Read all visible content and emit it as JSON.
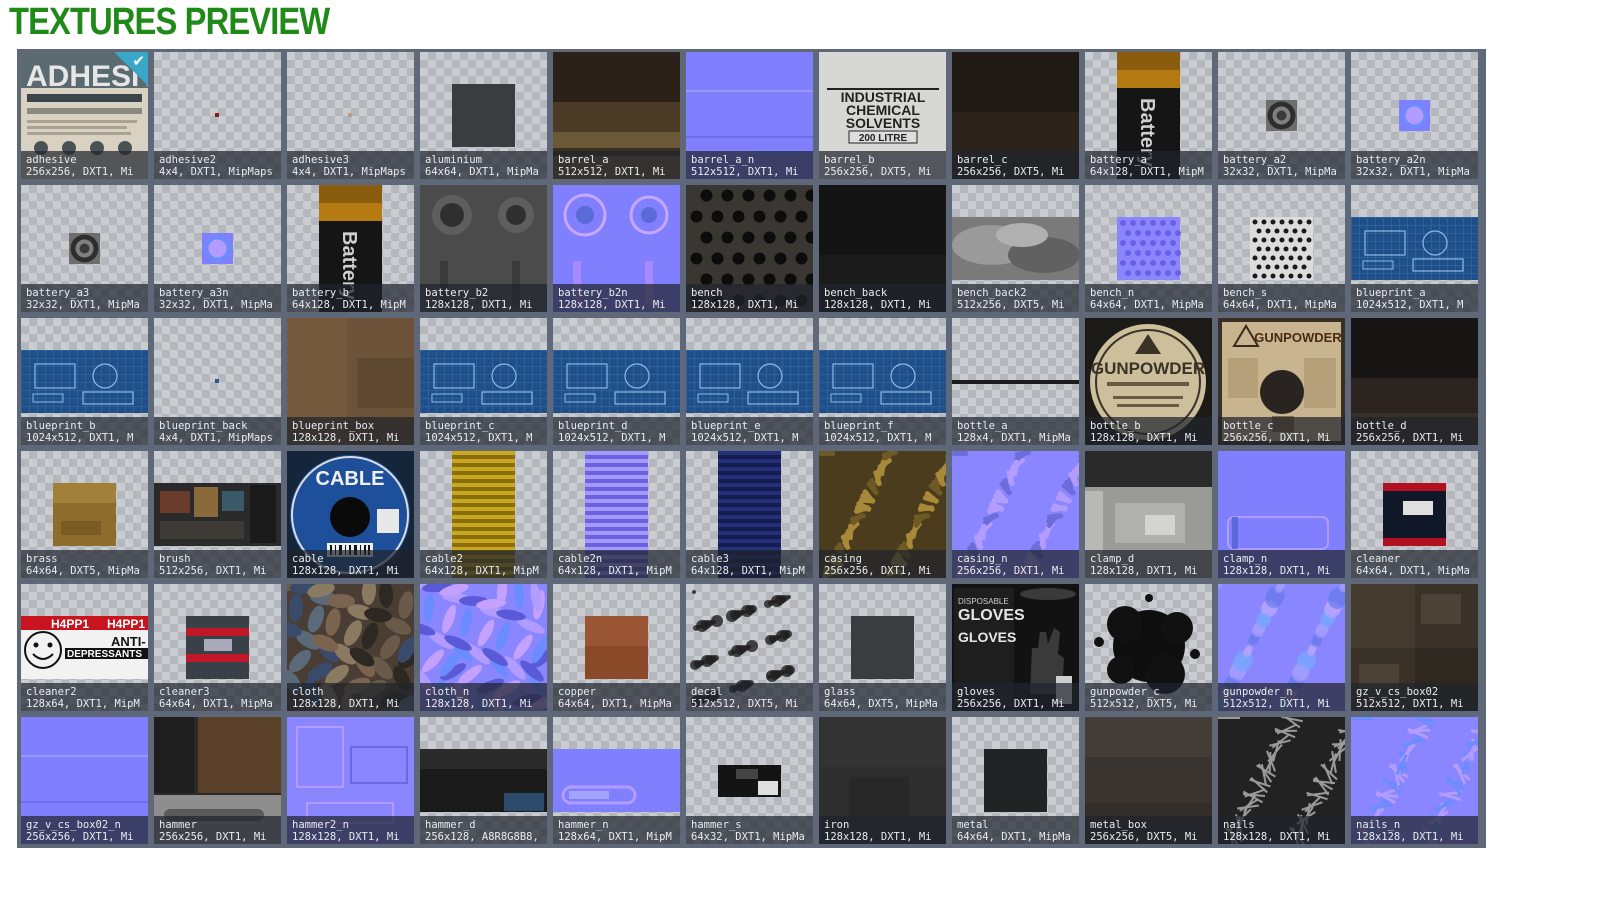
{
  "page": {
    "title": "TEXTURES PREVIEW"
  },
  "textures": [
    {
      "name": "adhesive",
      "info": "256x256, DXT1, Mi",
      "look": "adhesive",
      "selected": true
    },
    {
      "name": "adhesive2",
      "info": "4x4, DXT1, MipMaps",
      "look": "dot-red"
    },
    {
      "name": "adhesive3",
      "info": "4x4, DXT1, MipMaps",
      "look": "dot-tan"
    },
    {
      "name": "aluminium",
      "info": "64x64, DXT1, MipMa",
      "look": "square-dark"
    },
    {
      "name": "barrel_a",
      "info": "512x512, DXT1, Mi",
      "look": "barrel"
    },
    {
      "name": "barrel_a_n",
      "info": "512x512, DXT1, Mi",
      "look": "normal"
    },
    {
      "name": "barrel_b",
      "info": "256x256, DXT5, Mi",
      "look": "chem-label",
      "label_lines": [
        "INDUSTRIAL",
        "CHEMICAL",
        "SOLVENTS",
        "200 LITRE"
      ]
    },
    {
      "name": "barrel_c",
      "info": "256x256, DXT5, Mi",
      "look": "dark-wood"
    },
    {
      "name": "battery_a",
      "info": "64x128, DXT1, MipM",
      "look": "battery-label",
      "label_text": "Battery"
    },
    {
      "name": "battery_a2",
      "info": "32x32, DXT1, MipMa",
      "look": "small-disc"
    },
    {
      "name": "battery_a2n",
      "info": "32x32, DXT1, MipMa",
      "look": "small-disc-n"
    },
    {
      "name": "battery_a3",
      "info": "32x32, DXT1, MipMa",
      "look": "small-disc"
    },
    {
      "name": "battery_a3n",
      "info": "32x32, DXT1, MipMa",
      "look": "small-disc-n"
    },
    {
      "name": "battery_b",
      "info": "64x128, DXT1, MipM",
      "look": "battery-label",
      "label_text": "Battery"
    },
    {
      "name": "battery_b2",
      "info": "128x128, DXT1, Mi",
      "look": "metal-knobs"
    },
    {
      "name": "battery_b2n",
      "info": "128x128, DXT1, Mi",
      "look": "normal-knobs"
    },
    {
      "name": "bench",
      "info": "128x128, DXT1, Mi",
      "look": "dots-dark"
    },
    {
      "name": "bench_back",
      "info": "128x128, DXT1, Mi",
      "look": "black"
    },
    {
      "name": "bench_back2",
      "info": "512x256, DXT5, Mi",
      "look": "cloud"
    },
    {
      "name": "bench_n",
      "info": "64x64, DXT1, MipMa",
      "look": "normal-square"
    },
    {
      "name": "bench_s",
      "info": "64x64, DXT1, MipMa",
      "look": "dots-light"
    },
    {
      "name": "blueprint_a",
      "info": "1024x512, DXT1, M",
      "look": "blueprint"
    },
    {
      "name": "blueprint_b",
      "info": "1024x512, DXT1, M",
      "look": "blueprint"
    },
    {
      "name": "blueprint_back",
      "info": "4x4, DXT1, MipMaps",
      "look": "dot-blue"
    },
    {
      "name": "blueprint_box",
      "info": "128x128, DXT1, Mi",
      "look": "cardboard"
    },
    {
      "name": "blueprint_c",
      "info": "1024x512, DXT1, M",
      "look": "blueprint"
    },
    {
      "name": "blueprint_d",
      "info": "1024x512, DXT1, M",
      "look": "blueprint"
    },
    {
      "name": "blueprint_e",
      "info": "1024x512, DXT1, M",
      "look": "blueprint"
    },
    {
      "name": "blueprint_f",
      "info": "1024x512, DXT1, M",
      "look": "blueprint"
    },
    {
      "name": "bottle_a",
      "info": "128x4, DXT1, MipMa",
      "look": "line"
    },
    {
      "name": "bottle_b",
      "info": "128x128, DXT1, Mi",
      "look": "gunpowder-label",
      "label_text": "GUNPOWDER"
    },
    {
      "name": "bottle_c",
      "info": "256x256, DXT1, Mi",
      "look": "gunpowder-box",
      "label_text": "GUNPOWDER"
    },
    {
      "name": "bottle_d",
      "info": "256x256, DXT1, Mi",
      "look": "dark-grad"
    },
    {
      "name": "brass",
      "info": "64x64, DXT5, MipMa",
      "look": "brass"
    },
    {
      "name": "brush",
      "info": "512x256, DXT1, Mi",
      "look": "brush"
    },
    {
      "name": "cable",
      "info": "128x128, DXT1, Mi",
      "look": "cable",
      "label_text": "CABLE"
    },
    {
      "name": "cable2",
      "info": "64x128, DXT1, MipM",
      "look": "stripes-yellow"
    },
    {
      "name": "cable2n",
      "info": "64x128, DXT1, MipM",
      "look": "stripes-normal"
    },
    {
      "name": "cable3",
      "info": "64x128, DXT1, MipM",
      "look": "stripes-navy"
    },
    {
      "name": "casing",
      "info": "256x256, DXT1, Mi",
      "look": "casing"
    },
    {
      "name": "casing_n",
      "info": "256x256, DXT1, Mi",
      "look": "casing-n"
    },
    {
      "name": "clamp_d",
      "info": "128x128, DXT1, Mi",
      "look": "clamp"
    },
    {
      "name": "clamp_n",
      "info": "128x128, DXT1, Mi",
      "look": "clamp-n"
    },
    {
      "name": "cleaner",
      "info": "64x64, DXT1, MipMa",
      "look": "cleaner"
    },
    {
      "name": "cleaner2",
      "info": "128x64, DXT1, MipM",
      "look": "pills",
      "label_lines": [
        "H4PP1",
        "H4PP1",
        "ANTI-",
        "DEPRESSANTS"
      ]
    },
    {
      "name": "cleaner3",
      "info": "64x64, DXT1, MipMa",
      "look": "cleaner3"
    },
    {
      "name": "cloth",
      "info": "128x128, DXT1, Mi",
      "look": "cloth"
    },
    {
      "name": "cloth_n",
      "info": "128x128, DXT1, Mi",
      "look": "cloth-n"
    },
    {
      "name": "copper",
      "info": "64x64, DXT1, MipMa",
      "look": "copper"
    },
    {
      "name": "decal",
      "info": "512x512, DXT5, Mi",
      "look": "decal"
    },
    {
      "name": "glass",
      "info": "64x64, DXT5, MipMa",
      "look": "square-dark"
    },
    {
      "name": "gloves",
      "info": "256x256, DXT1, Mi",
      "look": "gloves",
      "label_lines": [
        "DISPOSABLE",
        "GLOVES",
        "GLOVES"
      ]
    },
    {
      "name": "gunpowder_c",
      "info": "512x512, DXT5, Mi",
      "look": "splat"
    },
    {
      "name": "gunpowder_n",
      "info": "512x512, DXT1, Mi",
      "look": "normal-noise"
    },
    {
      "name": "gz_v_cs_box02",
      "info": "512x512, DXT1, Mi",
      "look": "box-dark"
    },
    {
      "name": "gz_v_cs_box02_n",
      "info": "256x256, DXT1, Mi",
      "look": "normal"
    },
    {
      "name": "hammer",
      "info": "256x256, DXT1, Mi",
      "look": "hammer"
    },
    {
      "name": "hammer2_n",
      "info": "128x128, DXT1, Mi",
      "look": "hammer-n"
    },
    {
      "name": "hammer_d",
      "info": "256x128, A8R8G8B8,",
      "look": "hammer-d"
    },
    {
      "name": "hammer_n",
      "info": "128x64, DXT1, MipM",
      "look": "hammer-nn"
    },
    {
      "name": "hammer_s",
      "info": "64x32, DXT1, MipMa",
      "look": "hammer-s"
    },
    {
      "name": "iron",
      "info": "128x128, DXT1, Mi",
      "look": "iron"
    },
    {
      "name": "metal",
      "info": "64x64, DXT1, MipMa",
      "look": "square-black"
    },
    {
      "name": "metal_box",
      "info": "256x256, DXT5, Mi",
      "look": "metal-box"
    },
    {
      "name": "nails",
      "info": "128x128, DXT1, Mi",
      "look": "nails"
    },
    {
      "name": "nails_n",
      "info": "128x128, DXT1, Mi",
      "look": "nails-n"
    }
  ]
}
